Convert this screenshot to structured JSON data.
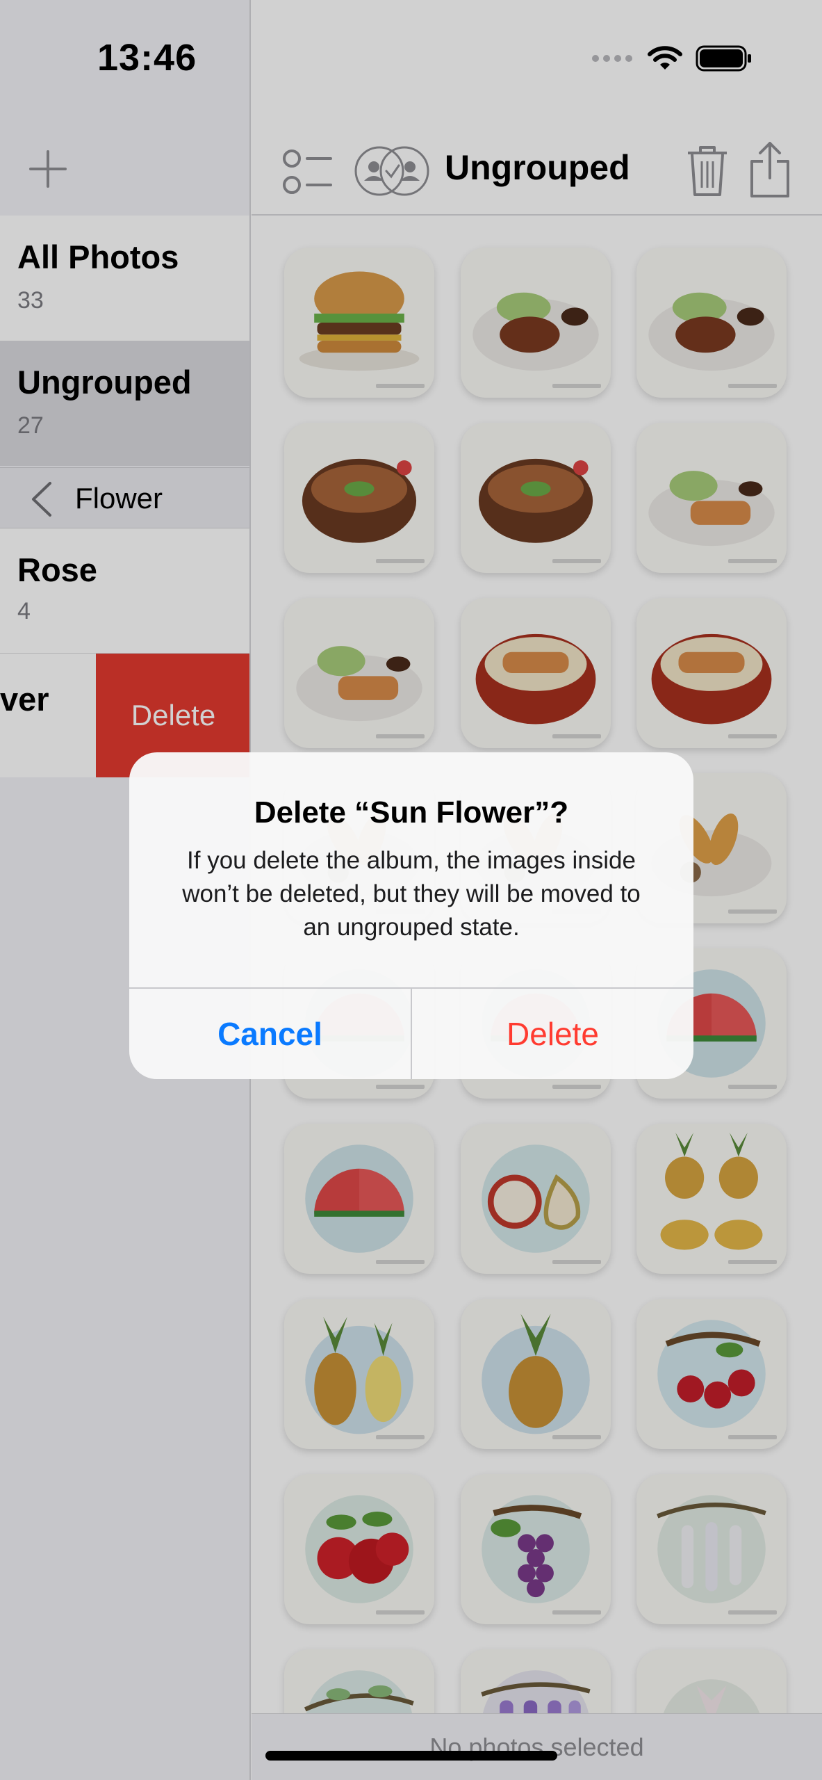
{
  "status": {
    "time": "13:46"
  },
  "sidebar": {
    "albums": [
      {
        "title": "All Photos",
        "count": "33"
      },
      {
        "title": "Ungrouped",
        "count": "27"
      }
    ],
    "folder": {
      "label": "Flower"
    },
    "folder_albums": [
      {
        "title": "Rose",
        "count": "4"
      },
      {
        "title": "ver"
      }
    ],
    "swipe_action_label": "Delete"
  },
  "main": {
    "title": "Ungrouped",
    "bottom_status": "No photos selected",
    "photos": [
      "burger",
      "pork-plate",
      "pork-plate",
      "gyudon",
      "gyudon",
      "katsu-plate",
      "katsu-plate",
      "katsudon",
      "katsudon",
      "tempura",
      "tempura",
      "tempura",
      "watermelon",
      "watermelon",
      "watermelon",
      "watermelon",
      "apple-pear",
      "pineapple-halves",
      "pineapple-pair",
      "pineapple",
      "cherries",
      "apples",
      "grapes",
      "wisteria",
      "branch",
      "wisteria-purple",
      "lily"
    ]
  },
  "alert": {
    "title": "Delete “Sun Flower”?",
    "message": "If you delete the album, the images inside won’t be deleted, but they will be moved to an ungrouped state.",
    "cancel": "Cancel",
    "delete": "Delete"
  },
  "colors": {
    "accent": "#0a7aff",
    "destructive": "#ff3b30",
    "swipe_delete": "#e33a2f"
  }
}
